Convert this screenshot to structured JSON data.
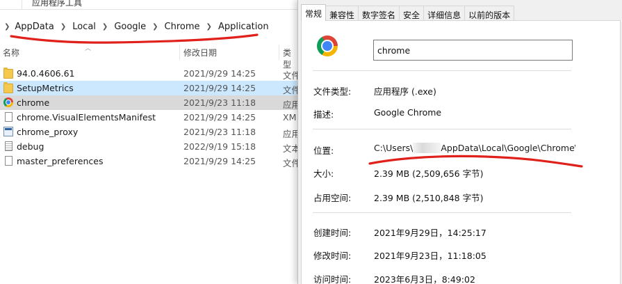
{
  "explorer": {
    "ribbon_tabs": [
      "",
      "应用程序工具"
    ],
    "breadcrumb": [
      "AppData",
      "Local",
      "Google",
      "Chrome",
      "Application"
    ],
    "columns": {
      "name": "名称",
      "date": "修改日期",
      "type": "类型"
    },
    "files": [
      {
        "name": "94.0.4606.61",
        "date": "2021/9/29 14:25",
        "type": "文件",
        "icon": "folder-icon",
        "state": "normal"
      },
      {
        "name": "SetupMetrics",
        "date": "2021/9/29 14:25",
        "type": "文件",
        "icon": "folder-icon",
        "state": "hover"
      },
      {
        "name": "chrome",
        "date": "2021/9/23 11:18",
        "type": "应用",
        "icon": "chrome-icon",
        "state": "selected"
      },
      {
        "name": "chrome.VisualElementsManifest",
        "date": "2021/9/29 14:25",
        "type": "XM",
        "icon": "file-icon",
        "state": "normal"
      },
      {
        "name": "chrome_proxy",
        "date": "2021/9/23 11:18",
        "type": "应用",
        "icon": "exe-icon",
        "state": "normal"
      },
      {
        "name": "debug",
        "date": "2022/9/19 15:18",
        "type": "文本",
        "icon": "text-file-icon",
        "state": "normal"
      },
      {
        "name": "master_preferences",
        "date": "2021/9/29 14:25",
        "type": "文件",
        "icon": "file-icon",
        "state": "normal"
      }
    ]
  },
  "properties": {
    "tabs": [
      "常规",
      "兼容性",
      "数字签名",
      "安全",
      "详细信息",
      "以前的版本"
    ],
    "active_tab": "常规",
    "file_name": "chrome",
    "rows": {
      "file_type": {
        "label": "文件类型:",
        "value": "应用程序 (.exe)"
      },
      "description": {
        "label": "描述:",
        "value": "Google Chrome"
      },
      "location": {
        "label": "位置:",
        "value_prefix": "C:\\Users\\",
        "value_suffix": "AppData\\Local\\Google\\Chrome\\"
      },
      "size": {
        "label": "大小:",
        "value": "2.39 MB (2,509,656 字节)"
      },
      "disk_size": {
        "label": "占用空间:",
        "value": "2.39 MB (2,510,848 字节)"
      },
      "created": {
        "label": "创建时间:",
        "value": "2021年9月29日，14:25:17"
      },
      "modified": {
        "label": "修改时间:",
        "value": "2021年9月23日，11:18:05"
      },
      "accessed": {
        "label": "访问时间:",
        "value": "2023年6月3日，8:49:02"
      }
    }
  },
  "colors": {
    "selection": "#cce8ff",
    "selected_row": "#d9d9d9",
    "annotation_red": "#e0201a",
    "dialog_bg": "#f0f0f0"
  }
}
